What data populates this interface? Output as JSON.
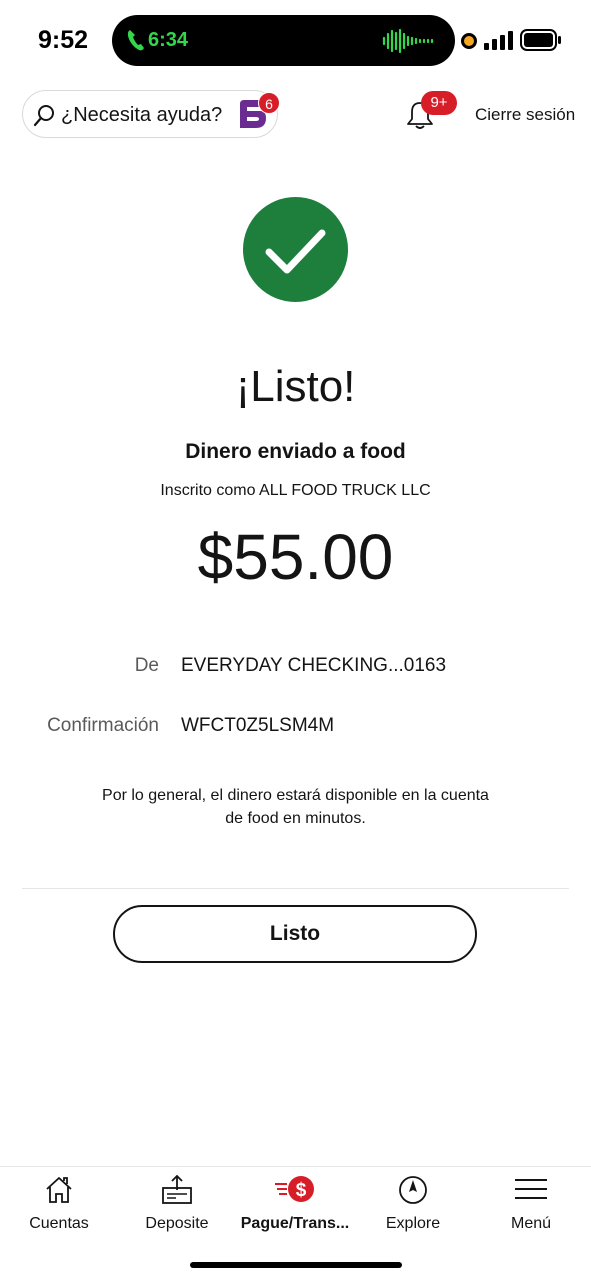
{
  "status_bar": {
    "time": "9:52",
    "call_timer": "6:34"
  },
  "header": {
    "search_placeholder": "¿Necesita ayuda?",
    "fargo_badge": "6",
    "notifications_badge": "9+",
    "logout_label": "Cierre sesión"
  },
  "confirmation": {
    "title": "¡Listo!",
    "subtitle": "Dinero enviado a food",
    "enrolled_as": "Inscrito como ALL FOOD TRUCK LLC",
    "amount": "$55.00",
    "details": [
      {
        "label": "De",
        "value": "EVERYDAY CHECKING...0163"
      },
      {
        "label": "Confirmación",
        "value": "WFCT0Z5LSM4M"
      }
    ],
    "note": "Por lo general, el dinero estará disponible en la cuenta de food en minutos.",
    "done_label": "Listo"
  },
  "bottom_nav": {
    "items": [
      {
        "label": "Cuentas",
        "icon": "home-icon"
      },
      {
        "label": "Deposite",
        "icon": "deposit-icon"
      },
      {
        "label": "Pague/Trans...",
        "icon": "pay-transfer-icon",
        "active": true
      },
      {
        "label": "Explore",
        "icon": "compass-icon"
      },
      {
        "label": "Menú",
        "icon": "menu-icon"
      }
    ]
  },
  "colors": {
    "success_green": "#1e7f3c",
    "brand_red": "#d71e28",
    "fargo_purple": "#6b2c91"
  }
}
